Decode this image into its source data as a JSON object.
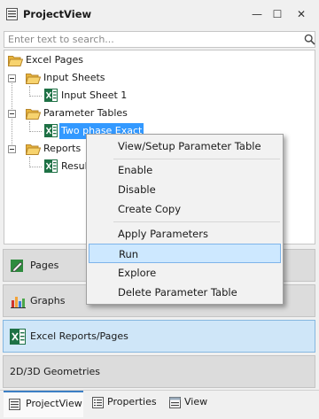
{
  "window": {
    "title": "ProjectView",
    "minimize_glyph": "—",
    "maximize_glyph": "☐",
    "close_glyph": "✕"
  },
  "search": {
    "placeholder": "Enter text to search..."
  },
  "tree": {
    "root": "Excel Pages",
    "input_sheets": "Input Sheets",
    "input_sheet_1": "Input Sheet 1",
    "parameter_tables": "Parameter Tables",
    "two_phase_exact": "Two phase Exact",
    "reports": "Reports",
    "results": "Results"
  },
  "context_menu": {
    "view_setup": "View/Setup Parameter Table",
    "enable": "Enable",
    "disable": "Disable",
    "create_copy": "Create Copy",
    "apply_parameters": "Apply Parameters",
    "run": "Run",
    "explore": "Explore",
    "delete": "Delete Parameter Table"
  },
  "nav": {
    "pages": "Pages",
    "graphs": "Graphs",
    "excel_reports": "Excel Reports/Pages",
    "geometries": "2D/3D Geometries"
  },
  "bottom_tabs": {
    "projectview": "ProjectView",
    "properties": "Properties",
    "view": "View"
  },
  "colors": {
    "selection": "#3399ff",
    "menu_highlight": "#cde8ff",
    "excel_green": "#1e7145",
    "folder_yellow": "#f2c14e",
    "active_nav": "#cfe6f8"
  }
}
